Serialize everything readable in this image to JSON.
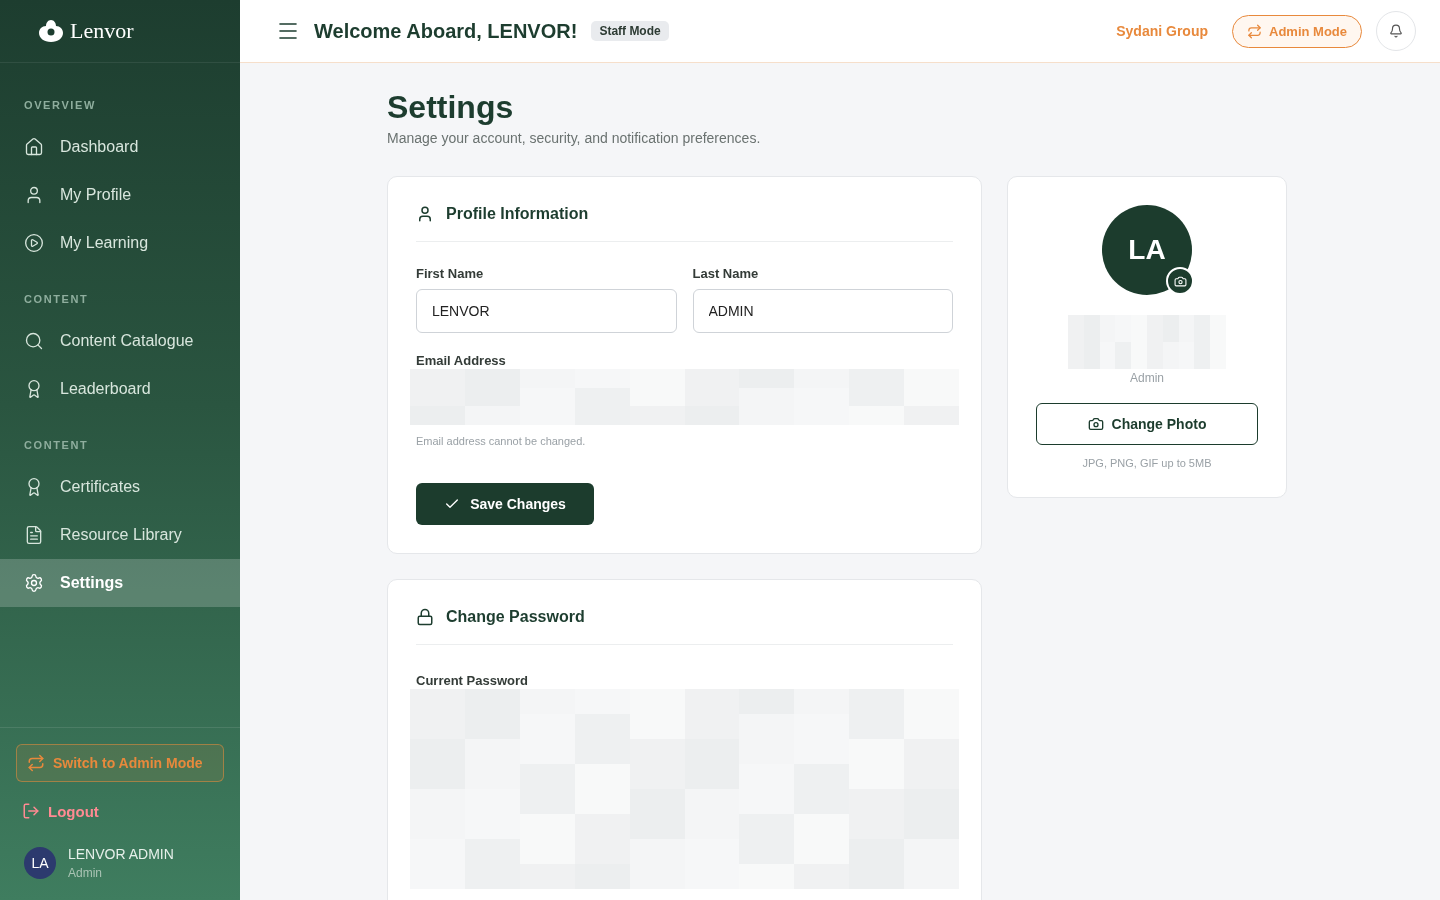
{
  "brand": {
    "name": "Lenvor"
  },
  "sidebar": {
    "sections": [
      {
        "heading": "OVERVIEW",
        "items": [
          {
            "label": "Dashboard",
            "selected": false
          },
          {
            "label": "My Profile",
            "selected": false
          },
          {
            "label": "My Learning",
            "selected": false
          }
        ]
      },
      {
        "heading": "CONTENT",
        "items": [
          {
            "label": "Content Catalogue",
            "selected": false
          },
          {
            "label": "Leaderboard",
            "selected": false
          }
        ]
      },
      {
        "heading": "CONTENT",
        "items": [
          {
            "label": "Certificates",
            "selected": false
          },
          {
            "label": "Resource Library",
            "selected": false
          },
          {
            "label": "Settings",
            "selected": true
          }
        ]
      }
    ],
    "switch_button": "Switch to Admin Mode",
    "logout": "Logout",
    "user": {
      "initials": "LA",
      "name": "LENVOR ADMIN",
      "role": "Admin"
    }
  },
  "header": {
    "greeting": "Welcome Aboard, LENVOR!",
    "mode_badge": "Staff Mode",
    "org": "Sydani Group",
    "admin_button": "Admin Mode"
  },
  "page": {
    "title": "Settings",
    "subtitle": "Manage your account, security, and notification preferences."
  },
  "profile_card": {
    "title": "Profile Information",
    "fields": [
      {
        "label": "First Name",
        "value": "LENVOR"
      },
      {
        "label": "Last Name",
        "value": "ADMIN"
      }
    ],
    "email_label": "Email Address",
    "email_hint": "Email address cannot be changed.",
    "save_button": "Save Changes"
  },
  "photo_card": {
    "initials": "LA",
    "role": "Admin",
    "button": "Change Photo",
    "hint": "JPG, PNG, GIF up to 5MB"
  },
  "password_card": {
    "title": "Change Password",
    "field_label": "Current Password"
  }
}
